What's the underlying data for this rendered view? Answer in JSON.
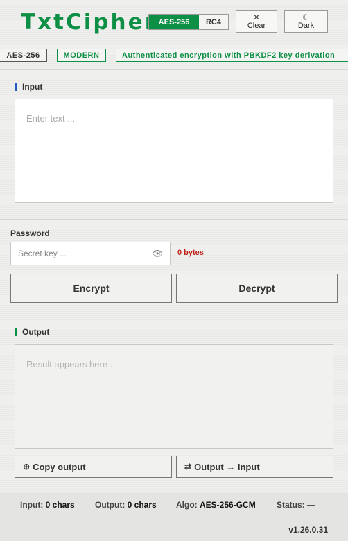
{
  "app": {
    "title": "TxtCipher",
    "brand_color": "#0e8f46"
  },
  "header": {
    "algo_options": [
      {
        "label": "AES-256",
        "active": true
      },
      {
        "label": "RC4",
        "active": false
      }
    ],
    "clear_button": {
      "icon": "close-icon",
      "label": "Clear"
    },
    "dark_button": {
      "icon": "moon-icon",
      "label": "Dark"
    }
  },
  "tags": {
    "algo": "AES-256",
    "kind": "MODERN",
    "description": "Authenticated encryption with PBKDF2 key derivation"
  },
  "input_section": {
    "title": "Input",
    "accent": "#2159c9",
    "placeholder": "Enter text ..."
  },
  "password": {
    "label": "Password",
    "placeholder": "Secret key ...",
    "icon": "eye-icon",
    "byte_count": "0 bytes",
    "byte_color": "#c0211a"
  },
  "actions": {
    "encrypt": "Encrypt",
    "decrypt": "Decrypt"
  },
  "output_section": {
    "title": "Output",
    "accent": "#0e8f46",
    "placeholder": "Result appears here ...",
    "copy_button": {
      "icon": "copy-icon",
      "label": "Copy output"
    },
    "swap_button": {
      "icon": "swap-icon",
      "label": "Output → Input"
    }
  },
  "status": {
    "input_label": "Input:",
    "input_value": "0 chars",
    "output_label": "Output:",
    "output_value": "0 chars",
    "algo_label": "Algo:",
    "algo_value": "AES-256-GCM",
    "status_label": "Status:",
    "status_value": "—",
    "version": "v1.26.0.31"
  }
}
